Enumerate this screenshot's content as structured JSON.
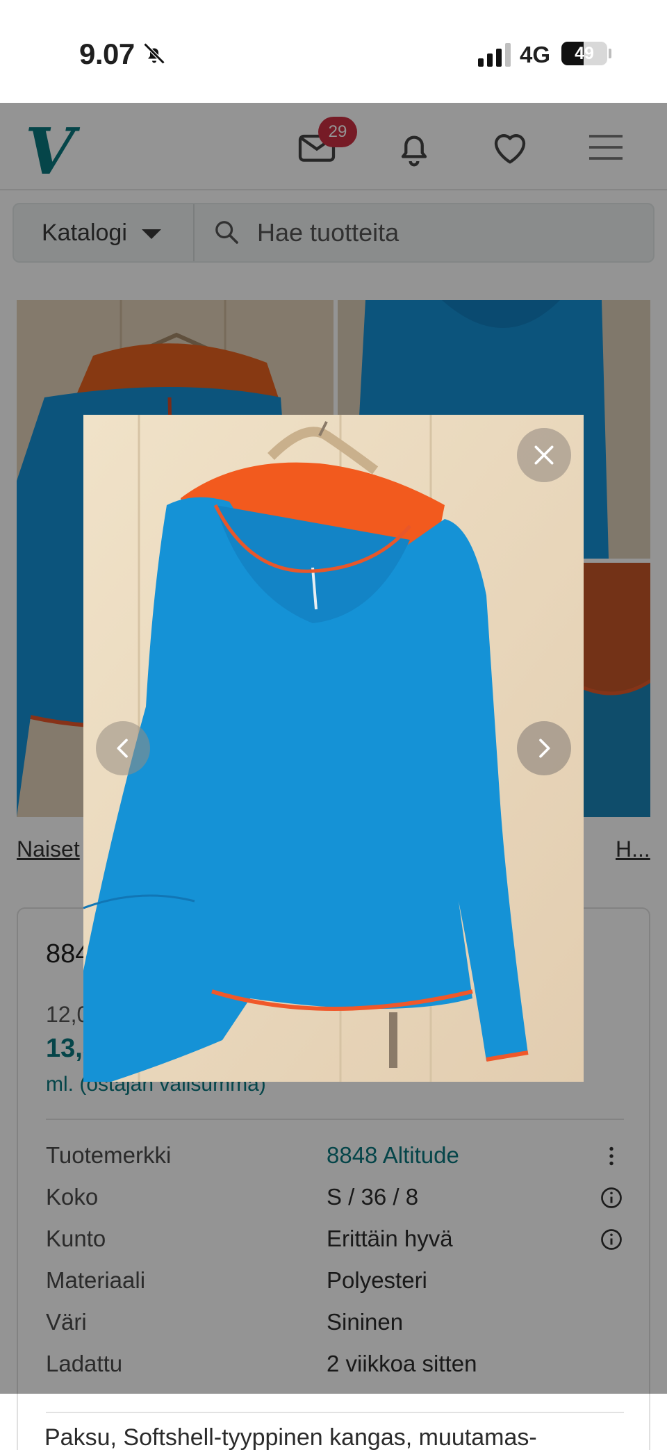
{
  "status_bar": {
    "time": "9.07",
    "network": "4G",
    "battery_level": "49",
    "battery_fraction": 0.49
  },
  "header": {
    "logo": "V",
    "messages_badge": "29"
  },
  "search": {
    "catalog_label": "Katalogi",
    "placeholder": "Hae tuotteita"
  },
  "breadcrumbs": {
    "first": "Naiset",
    "last": "H..."
  },
  "item": {
    "title": "884",
    "price_original": "12,0",
    "price_with_protection": "13,3",
    "buyer_note": "ml. (ostajan valisumma)",
    "details": [
      {
        "label": "Tuotemerkki",
        "value": "8848 Altitude",
        "icon": "more-vertical-icon"
      },
      {
        "label": "Koko",
        "value": "S / 36 / 8",
        "icon": "info-icon"
      },
      {
        "label": "Kunto",
        "value": "Erittäin hyvä",
        "icon": "info-icon"
      },
      {
        "label": "Materiaali",
        "value": "Polyesteri"
      },
      {
        "label": "Väri",
        "value": "Sininen"
      },
      {
        "label": "Ladattu",
        "value": "2 viikkoa sitten"
      }
    ],
    "description_preview": "Paksu, Softshell-tyyppinen kangas, muutamas-"
  },
  "colors": {
    "accent": "#09777f",
    "badge": "#cc2f43",
    "jacket_blue": "#1590d6",
    "hood_orange": "#f05a1e",
    "trim_orange": "#e8572a"
  },
  "icons": [
    "bell-off-icon",
    "signal-icon",
    "battery-icon",
    "mail-icon",
    "bell-icon",
    "heart-icon",
    "menu-icon",
    "search-icon",
    "chevron-down-icon",
    "close-icon",
    "chevron-left-icon",
    "chevron-right-icon"
  ]
}
